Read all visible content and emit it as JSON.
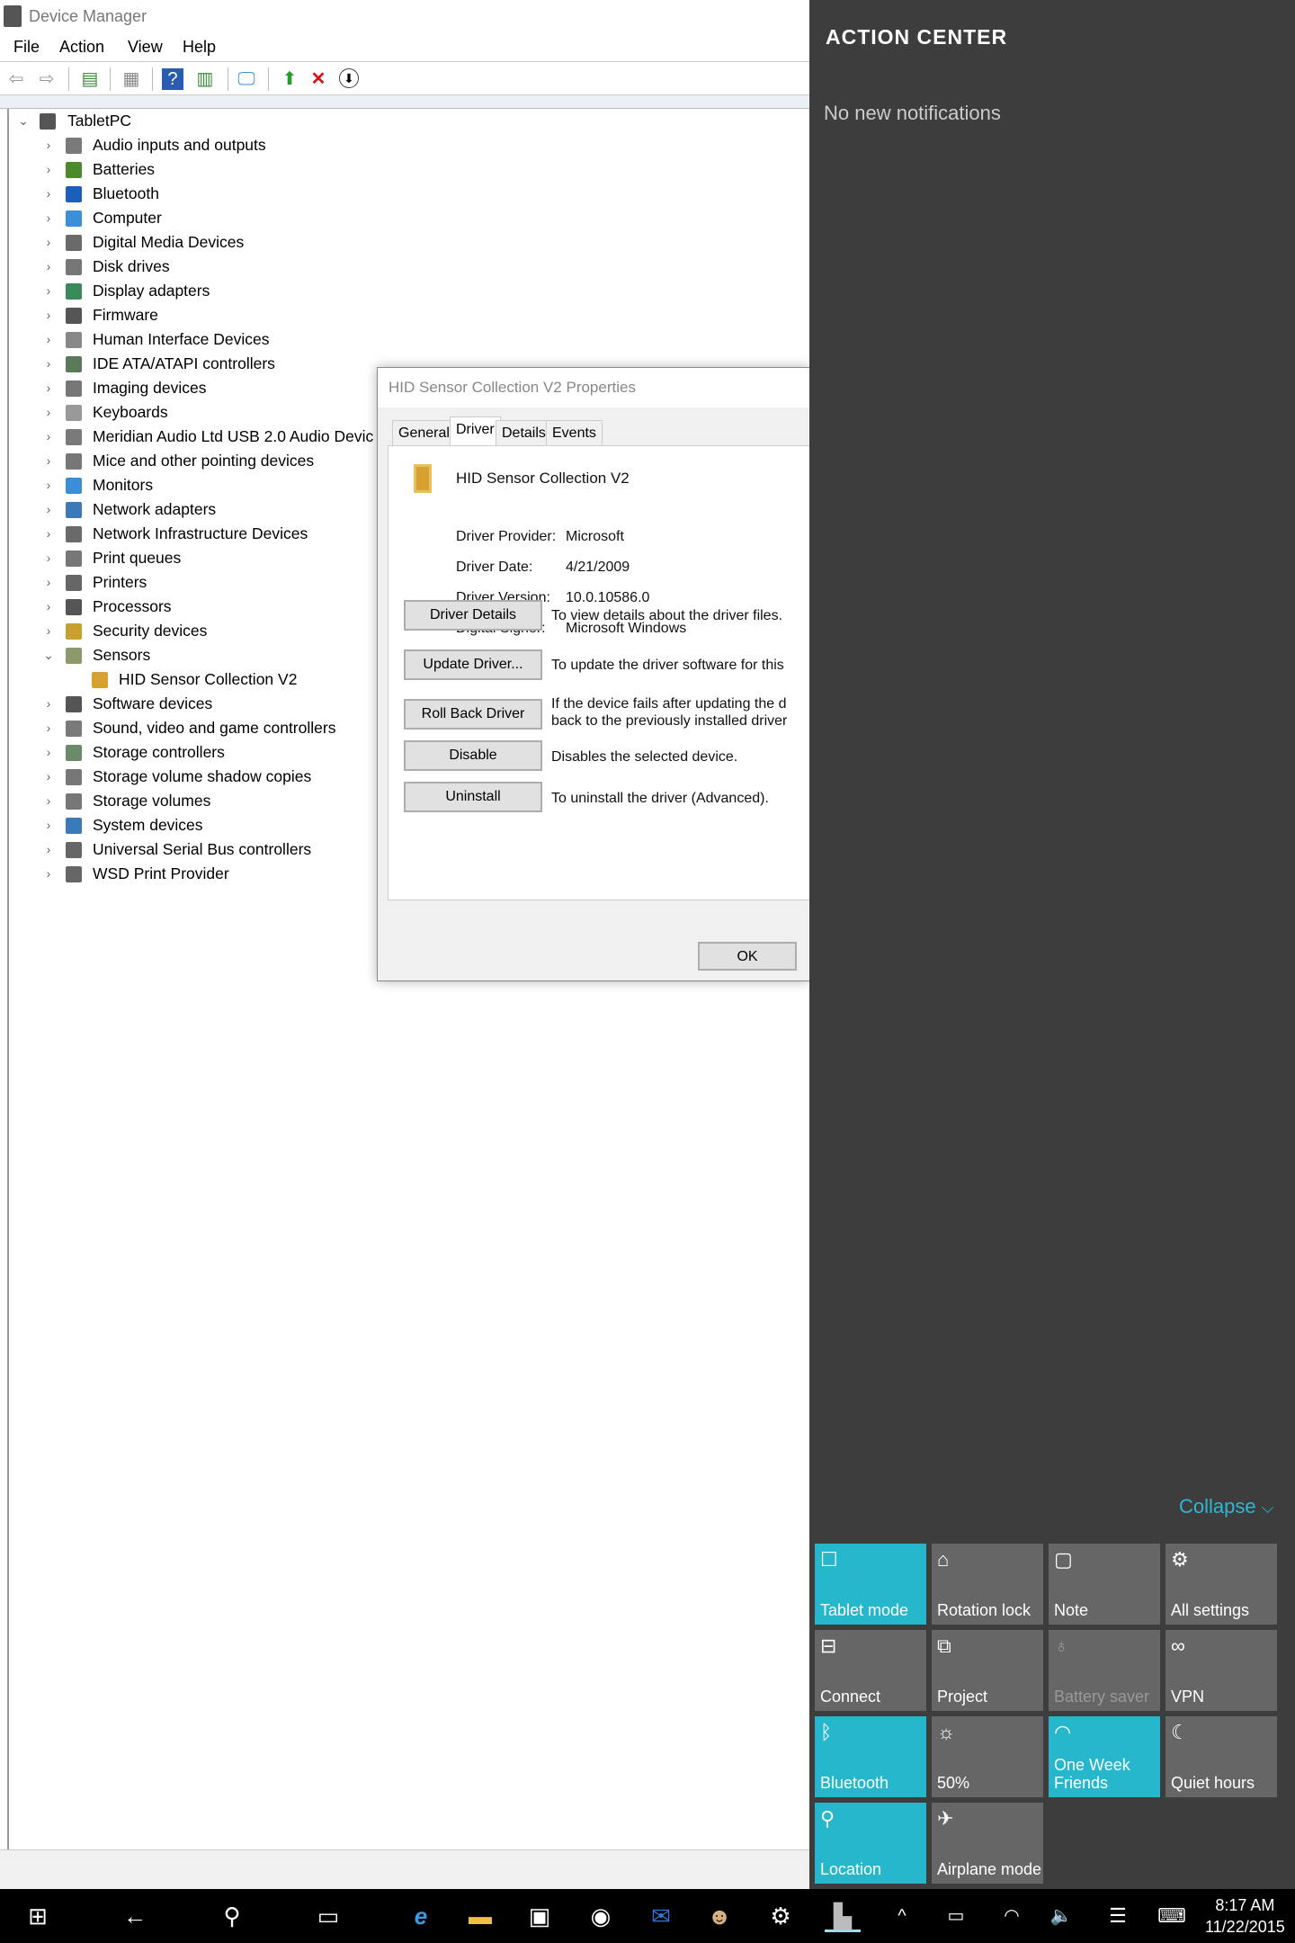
{
  "window": {
    "title": "Device Manager"
  },
  "menu": [
    "File",
    "Action",
    "View",
    "Help"
  ],
  "toolbar": [
    "back-icon",
    "forward-icon",
    "show-hide-console-tree-icon",
    "properties-icon",
    "help-icon",
    "action-pane-icon",
    "scan-hardware-icon",
    "update-driver-icon",
    "uninstall-icon",
    "disable-icon"
  ],
  "tree": {
    "root": "TabletPC",
    "items": [
      {
        "label": "Audio inputs and outputs",
        "color": "#7a7a7a"
      },
      {
        "label": "Batteries",
        "color": "#4a8a2a"
      },
      {
        "label": "Bluetooth",
        "color": "#1c5fb8"
      },
      {
        "label": "Computer",
        "color": "#3a8fd8"
      },
      {
        "label": "Digital Media Devices",
        "color": "#6a6a6a"
      },
      {
        "label": "Disk drives",
        "color": "#777"
      },
      {
        "label": "Display adapters",
        "color": "#3a8a5a"
      },
      {
        "label": "Firmware",
        "color": "#555"
      },
      {
        "label": "Human Interface Devices",
        "color": "#888"
      },
      {
        "label": "IDE ATA/ATAPI controllers",
        "color": "#5a7a5a"
      },
      {
        "label": "Imaging devices",
        "color": "#777"
      },
      {
        "label": "Keyboards",
        "color": "#999"
      },
      {
        "label": "Meridian Audio Ltd USB 2.0 Audio Devic",
        "color": "#7a7a7a"
      },
      {
        "label": "Mice and other pointing devices",
        "color": "#777"
      },
      {
        "label": "Monitors",
        "color": "#3a8fd8"
      },
      {
        "label": "Network adapters",
        "color": "#3a7ab8"
      },
      {
        "label": "Network Infrastructure Devices",
        "color": "#6a6a6a"
      },
      {
        "label": "Print queues",
        "color": "#777"
      },
      {
        "label": "Printers",
        "color": "#666"
      },
      {
        "label": "Processors",
        "color": "#555"
      },
      {
        "label": "Security devices",
        "color": "#c8a030"
      },
      {
        "label": "Sensors",
        "color": "#8a9a6a",
        "expanded": true
      },
      {
        "label": "HID Sensor Collection V2",
        "color": "#d8a030",
        "child": true
      },
      {
        "label": "Software devices",
        "color": "#555"
      },
      {
        "label": "Sound, video and game controllers",
        "color": "#7a7a7a"
      },
      {
        "label": "Storage controllers",
        "color": "#6a8a6a"
      },
      {
        "label": "Storage volume shadow copies",
        "color": "#777"
      },
      {
        "label": "Storage volumes",
        "color": "#777"
      },
      {
        "label": "System devices",
        "color": "#3a7ab8"
      },
      {
        "label": "Universal Serial Bus controllers",
        "color": "#666"
      },
      {
        "label": "WSD Print Provider",
        "color": "#666"
      }
    ]
  },
  "dialog": {
    "title": "HID Sensor Collection V2 Properties",
    "tabs": [
      "General",
      "Driver",
      "Details",
      "Events"
    ],
    "active_tab": "Driver",
    "device_name": "HID Sensor Collection V2",
    "fields": [
      {
        "key": "Driver Provider:",
        "value": "Microsoft"
      },
      {
        "key": "Driver Date:",
        "value": "4/21/2009"
      },
      {
        "key": "Driver Version:",
        "value": "10.0.10586.0"
      },
      {
        "key": "Digital Signer:",
        "value": "Microsoft Windows"
      }
    ],
    "buttons": [
      {
        "label": "Driver Details",
        "desc": "To view details about the driver files."
      },
      {
        "label": "Update Driver...",
        "desc": "To update the driver software for this"
      },
      {
        "label": "Roll Back Driver",
        "desc": "If the device fails after updating the d",
        "desc2": "back to the previously installed driver"
      },
      {
        "label": "Disable",
        "desc": "Disables the selected device."
      },
      {
        "label": "Uninstall",
        "desc": "To uninstall the driver (Advanced)."
      }
    ],
    "ok": "OK"
  },
  "action_center": {
    "title": "ACTION CENTER",
    "empty": "No new notifications",
    "collapse": "Collapse",
    "accent": "#27b7cc",
    "tiles": [
      {
        "label": "Tablet mode",
        "icon": "tablet-mode-icon",
        "glyph": "☐",
        "on": true
      },
      {
        "label": "Rotation lock",
        "icon": "rotation-lock-icon",
        "glyph": "⌂"
      },
      {
        "label": "Note",
        "icon": "note-icon",
        "glyph": "▢"
      },
      {
        "label": "All settings",
        "icon": "gear-icon",
        "glyph": "⚙"
      },
      {
        "label": "Connect",
        "icon": "connect-icon",
        "glyph": "⊟"
      },
      {
        "label": "Project",
        "icon": "project-icon",
        "glyph": "⧉"
      },
      {
        "label": "Battery saver",
        "icon": "battery-saver-icon",
        "glyph": "♁",
        "disabled": true
      },
      {
        "label": "VPN",
        "icon": "vpn-icon",
        "glyph": "∞"
      },
      {
        "label": "Bluetooth",
        "icon": "bluetooth-icon",
        "glyph": "ᛒ",
        "on": true
      },
      {
        "label": "50%",
        "icon": "brightness-icon",
        "glyph": "☼"
      },
      {
        "label": "One Week Friends",
        "icon": "wifi-icon",
        "glyph": "◠",
        "on": true
      },
      {
        "label": "Quiet hours",
        "icon": "moon-icon",
        "glyph": "☾"
      },
      {
        "label": "Location",
        "icon": "location-icon",
        "glyph": "⚲",
        "on": true
      },
      {
        "label": "Airplane mode",
        "icon": "airplane-icon",
        "glyph": "✈"
      }
    ]
  },
  "taskbar": {
    "time": "8:17 AM",
    "date": "11/22/2015"
  }
}
